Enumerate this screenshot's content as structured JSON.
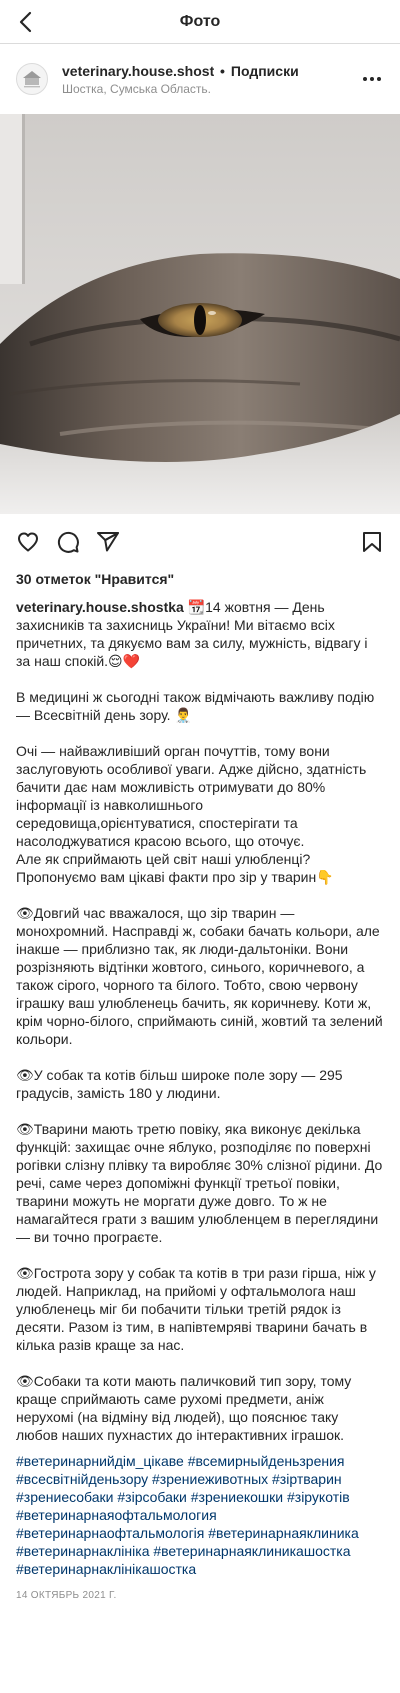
{
  "topbar": {
    "title": "Фото"
  },
  "post": {
    "username": "veterinary.house.shostka",
    "separator": "•",
    "follow_label": "Подписки",
    "location": "Шостка, Сумська Область.",
    "likes": "30 отметок \"Нравится\"",
    "caption_username": "veterinary.house.shostka",
    "caption_text": " 📆14 жовтня — День захисників та захисниць України! Ми вітаємо всіх причетних, та дякуємо вам за силу, мужність, відвагу і за наш спокій.😌❤️\n\nВ медицині ж сьогодні також відмічають важливу подію — Всесвітній день зору. 👨‍⚕️\n\nОчі — найважливіший орган почуттів, тому вони заслуговують особливої уваги. Адже дійсно, здатність бачити дає нам можливість отримувати до 80% інформації із навколишнього середовища,орієнтуватися, спостерігати та насолоджуватися красою всього, що оточує.\nАле як сприймають цей світ наші улюбленці? Пропонуємо вам цікаві факти про зір у тварин👇\n\n👁Довгий час вважалося, що зір тварин — монохромний. Насправді ж, собаки бачать кольори, але інакше — приблизно так, як люди-дальтоніки. Вони розрізняють відтінки жовтого, синього, коричневого, а також сірого, чорного та білого. Тобто, свою червону іграшку ваш улюбленець бачить, як коричневу. Коти ж, крім чорно-білого, сприймають синій, жовтий та зелений кольори.\n\n👁У собак та котів більш широке поле зору — 295 градусів, замість 180 у людини.\n\n👁Тварини мають третю повіку, яка виконує декілька функцій: захищає очне яблуко, розподіляє по поверхні рогівки слізну плівку та виробляє 30% слізної рідини. До речі, саме через допоміжні функції третьої повіки, тварини можуть не моргати дуже довго. То ж не намагайтеся грати з вашим улюбленцем в переглядини — ви точно програєте.\n\n👁Гострота зору у собак та котів в три рази гірша, ніж у людей. Наприклад, на прийомі у офтальмолога наш улюбленець міг би побачити тільки третій рядок із десяти. Разом із тим, в напівтемряві тварини бачать в кілька разів краще за нас.\n\n👁Собаки та коти мають паличковий тип зору, тому краще сприймають саме рухомі предмети, аніж нерухомі (на відміну від людей), що пояснює таку любов наших пухнастих до інтерактивних іграшок.",
    "hashtags": "#ветеринарнийдім_цікаве #всемирныйденьзрения #всесвітнійденьзору #зрениеживотных #зіртварин #зрениесобаки #зірсобаки #зрениекошки #зірукотів #ветеринарнаяофтальмология #ветеринарнаофтальмологія #ветеринарнаяклиника #ветеринарнаклініка #ветеринарнаяклиникашостка #ветеринарнаклінікашостка",
    "date": "14 ОКТЯБРЬ 2021 Г."
  },
  "icons": {
    "back": "chevron-left-icon",
    "more": "more-horizontal-icon",
    "like": "heart-icon",
    "comment": "comment-icon",
    "share": "paper-plane-icon",
    "save": "bookmark-icon"
  },
  "colors": {
    "text": "#262626",
    "muted": "#8e8e8e",
    "hashtag": "#00376b",
    "border": "#dbdbdb"
  }
}
